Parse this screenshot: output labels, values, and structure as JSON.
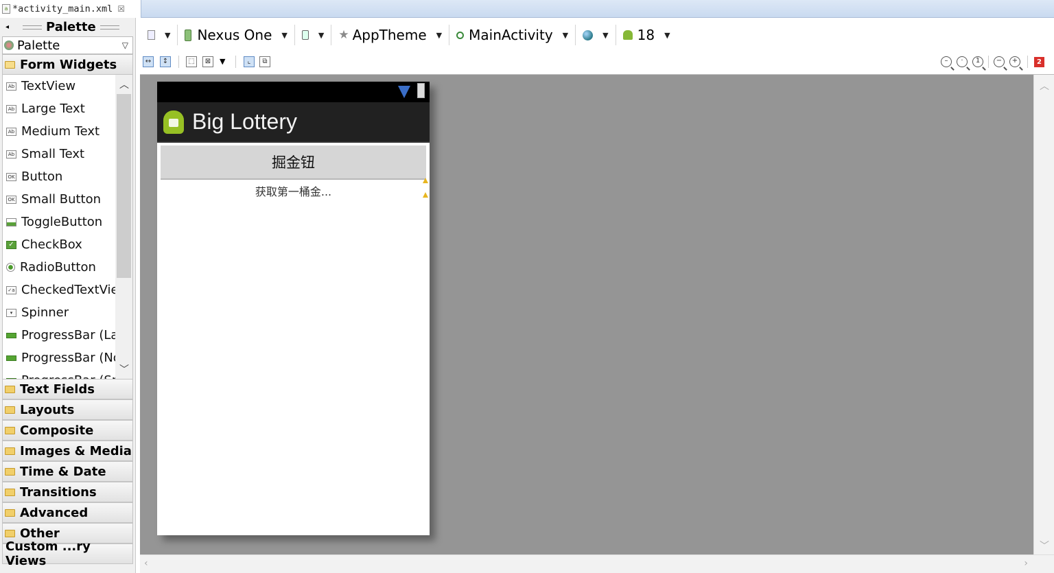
{
  "editor_tab": {
    "title": "*activity_main.xml",
    "close": "☒"
  },
  "palette": {
    "header": "Palette",
    "selector": "Palette",
    "open_category": "Form Widgets",
    "widgets": [
      {
        "label": "TextView",
        "icon": "ab-icon"
      },
      {
        "label": "Large Text",
        "icon": "ab-icon"
      },
      {
        "label": "Medium Text",
        "icon": "ab-icon"
      },
      {
        "label": "Small Text",
        "icon": "ab-icon"
      },
      {
        "label": "Button",
        "icon": "ok-icon"
      },
      {
        "label": "Small Button",
        "icon": "ok-icon"
      },
      {
        "label": "ToggleButton",
        "icon": "toggle-icon"
      },
      {
        "label": "CheckBox",
        "icon": "checkbox-icon"
      },
      {
        "label": "RadioButton",
        "icon": "radio-icon"
      },
      {
        "label": "CheckedTextView",
        "icon": "checked-text-icon"
      },
      {
        "label": "Spinner",
        "icon": "spinner-icon"
      },
      {
        "label": "ProgressBar (Large)",
        "icon": "progress-icon"
      },
      {
        "label": "ProgressBar (Normal)",
        "icon": "progress-icon"
      },
      {
        "label": "ProgressBar (Small)",
        "icon": "progress-icon"
      }
    ],
    "categories": [
      "Text Fields",
      "Layouts",
      "Composite",
      "Images & Media",
      "Time & Date",
      "Transitions",
      "Advanced",
      "Other"
    ],
    "last_category": "Custom ...ry Views"
  },
  "toolbar": {
    "device": "Nexus One",
    "theme": "AppTheme",
    "activity": "MainActivity",
    "api_level": "18"
  },
  "error_count": "2",
  "device_preview": {
    "app_title": "Big Lottery",
    "button_label": "掘金钮",
    "text_view": "获取第一桶金...",
    "action_bar_color": "#212121"
  }
}
